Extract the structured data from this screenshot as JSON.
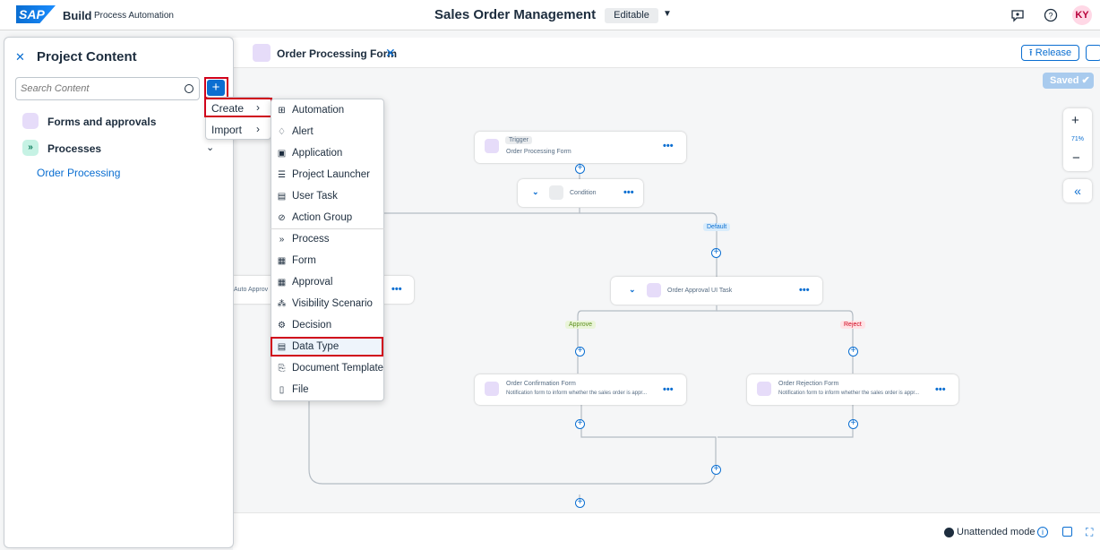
{
  "shell": {
    "logo": "SAP",
    "brand": "Build",
    "brand_sub": "Process Automation",
    "title": "Sales Order Management",
    "mode": "Editable",
    "avatar": "KY"
  },
  "toolbar": {
    "tab_label": "Order Processing Form",
    "release_label": "Release",
    "saved_label": "Saved"
  },
  "zoom": {
    "level": "71%"
  },
  "canvas": {
    "trigger_label": "Trigger",
    "trigger_name": "Order Processing Form",
    "condition_label": "Condition",
    "default_label": "Default",
    "auto_label": "Auto Approv",
    "approval_task": "Order Approval UI Task",
    "approve_label": "Approve",
    "reject_label": "Reject",
    "confirm_title": "Order Confirmation Form",
    "confirm_sub": "Notification form to inform whether the sales order is appr...",
    "reject_title": "Order Rejection Form",
    "reject_sub": "Notification form to inform whether the sales order is appr..."
  },
  "bottom": {
    "unattended": "Unattended mode"
  },
  "panel": {
    "title": "Project Content",
    "search_placeholder": "Search Content",
    "items": [
      {
        "label": "Forms and approvals"
      },
      {
        "label": "Processes"
      },
      {
        "label": "Order Processing"
      }
    ]
  },
  "menu": {
    "create": "Create",
    "import": "Import"
  },
  "submenu": {
    "items": [
      {
        "label": "Automation",
        "icon": "automation-icon"
      },
      {
        "label": "Alert",
        "icon": "bell-icon"
      },
      {
        "label": "Application",
        "icon": "application-icon"
      },
      {
        "label": "Project Launcher",
        "icon": "launcher-icon"
      },
      {
        "label": "User Task",
        "icon": "clipboard-icon"
      },
      {
        "label": "Action Group",
        "icon": "action-icon"
      },
      {
        "label": "Process",
        "icon": "process-icon"
      },
      {
        "label": "Form",
        "icon": "form-icon"
      },
      {
        "label": "Approval",
        "icon": "approval-icon"
      },
      {
        "label": "Visibility Scenario",
        "icon": "visibility-icon"
      },
      {
        "label": "Decision",
        "icon": "decision-icon"
      },
      {
        "label": "Data Type",
        "icon": "datatype-icon"
      },
      {
        "label": "Document Template",
        "icon": "document-template-icon"
      },
      {
        "label": "File",
        "icon": "file-icon"
      }
    ]
  }
}
